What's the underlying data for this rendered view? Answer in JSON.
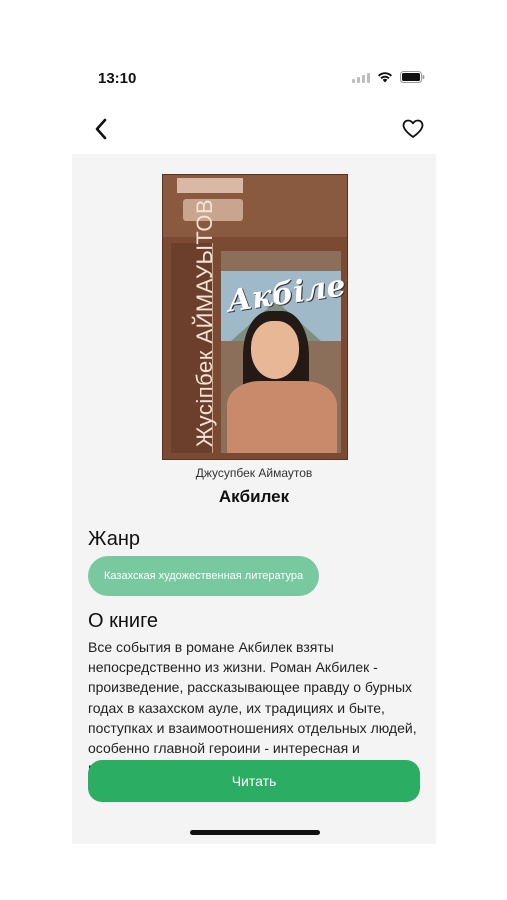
{
  "status_bar": {
    "time": "13:10"
  },
  "nav": {
    "back_icon": "chevron-left-icon",
    "favorite_icon": "heart-outline-icon"
  },
  "book": {
    "cover_author": "Жусіпбек АЙМАУЫТОВ",
    "cover_title": "Акбілек",
    "author": "Джусупбек Аймаутов",
    "title": "Акбилек"
  },
  "genre": {
    "heading": "Жанр",
    "chip": "Казахская художественная литература"
  },
  "about": {
    "heading": "О книге",
    "text": "Все события в романе Акбилек взяты непосредственно из жизни. Роман Акбилек - произведение, рассказывающее правду о бурных годах в казахском ауле, их традициях и быте, поступках и взаимоотношениях отдельных людей, особенно главной героини - интересная и поучительная жизнь многих романов, описывающий процесс изменения"
  },
  "actions": {
    "read_label": "Читать"
  },
  "colors": {
    "accent": "#2bad64",
    "chip": "#79c9a0",
    "content_bg": "#f4f4f4"
  }
}
